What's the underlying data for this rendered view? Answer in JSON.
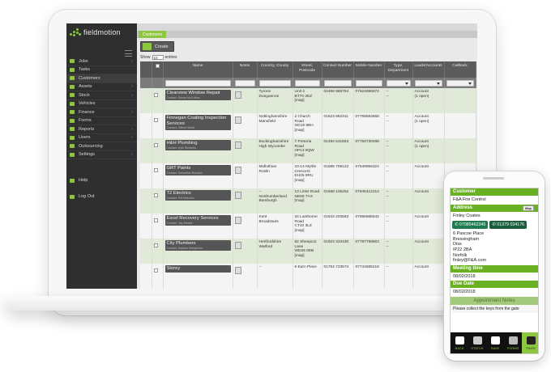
{
  "app": {
    "name": "fieldmotion"
  },
  "sidebar": {
    "items": [
      {
        "label": "Jobs",
        "arrow": "‹"
      },
      {
        "label": "Tasks",
        "arrow": ""
      },
      {
        "label": "Customers",
        "arrow": ""
      },
      {
        "label": "Assets",
        "arrow": "‹"
      },
      {
        "label": "Stock",
        "arrow": "‹"
      },
      {
        "label": "Vehicles",
        "arrow": ""
      },
      {
        "label": "Finance",
        "arrow": "‹"
      },
      {
        "label": "Forms",
        "arrow": ""
      },
      {
        "label": "Reports",
        "arrow": "‹"
      },
      {
        "label": "Users",
        "arrow": "‹"
      },
      {
        "label": "Outsourcing",
        "arrow": ""
      },
      {
        "label": "Settings",
        "arrow": "‹"
      }
    ],
    "help": "Help",
    "logout": "Log Out"
  },
  "tabs": {
    "active": "Customers"
  },
  "toolbar": {
    "create": "Create"
  },
  "table_controls": {
    "show": "Show",
    "entries_value": "10",
    "entries": "entries"
  },
  "table": {
    "headers": [
      "Name",
      "Notes",
      "Country, County",
      "Street, Postcode",
      "Contact Number",
      "Mobile Number",
      "Type, Department",
      "Leads/Accounts",
      "Callback"
    ],
    "rows": [
      {
        "name": "Clearview Window Repair",
        "contact": "Contact: Simon McCollins",
        "county": "Tyrone\nDungannon",
        "street": "Unit 2\nBT70 3EZ\n[map]",
        "phone": "02458 985754",
        "mobile": "07524896874",
        "type": "--\n--",
        "leads": "Account\n(1 open)"
      },
      {
        "name": "Finnegan Coating Inspection Services",
        "contact": "Contact: Gilbert Ward",
        "county": "Nottinghamshire\nMansfield",
        "street": "2 Church Road\nNG19 8BH\n[map]",
        "phone": "01623 882311",
        "mobile": "07768593658",
        "type": "--\n--",
        "leads": "Account\n(1 open)"
      },
      {
        "name": "H&H Plumbing",
        "contact": "Contact: Kyle Richards",
        "county": "Buckinghamshire\nHigh Wycombe",
        "street": "7 Pretoria Road\nHP13 6QW\n[map]",
        "phone": "01494 531553",
        "mobile": "07759730488",
        "type": "--\n--",
        "leads": "Account\n(1 open)"
      },
      {
        "name": "GRT Paints",
        "contact": "Contact: Sebastian Boulden",
        "county": "Midlothian\nRoslin",
        "street": "10-14 Myrtle Crescent\nEH25 9RU\n[map]",
        "phone": "01689 708122",
        "mobile": "07548956324",
        "type": "--\n--",
        "leads": "Account"
      },
      {
        "name": "T2 Electrics",
        "contact": "Contact: Pat Malcolm",
        "county": "--\nNorthumberland\nBamburgh",
        "street": "13 Links Road\nNE69 7AX\n[map]",
        "phone": "01668 105252",
        "mobile": "07845412214",
        "type": "--\n--",
        "leads": "Account"
      },
      {
        "name": "Excel Recovery Services",
        "contact": "Contact: Jay Weeks",
        "county": "Kent\nBroadstairs",
        "street": "34 Lanthorne Road\nCT10 3LZ\n[map]",
        "phone": "01843 203583",
        "mobile": "07966585542",
        "type": "--\n--",
        "leads": "Account"
      },
      {
        "name": "City Plumbers",
        "contact": "Contact: Andrew Humphries",
        "county": "Hertfordshire\nWatford",
        "street": "82 Sheepcot Lane\nWD25 0EB\n[map]",
        "phone": "01923 323430",
        "mobile": "07787799663",
        "type": "--\n--",
        "leads": "Account"
      },
      {
        "name": "Storey",
        "contact": "",
        "county": "--",
        "street": "6 Earn Place",
        "phone": "01764 723574",
        "mobile": "07744585218",
        "type": "--",
        "leads": "Account"
      }
    ]
  },
  "phone": {
    "customer_label": "Customer",
    "customer_value": "F&A Fire Control",
    "address_label": "Address",
    "map_label": "Map",
    "contact_name": "Finley Coates",
    "phone1": "07985462345",
    "phone2": "01379 034176",
    "address_lines": [
      "6 Pascoe Place",
      "Bressingham",
      "Diss",
      "IP22 2BA",
      "Norfolk",
      "finley@F&A.com"
    ],
    "meeting_label": "Meeting time",
    "meeting_value": "08/02/2018",
    "due_label": "Due Date",
    "due_value": "08/02/2018",
    "notes_label": "Appointment Notes",
    "notes_value": "Please collect the keys from the gate",
    "bottom_bar": [
      "BACK",
      "STATUS",
      "SAVE",
      "FORMS",
      "FILES"
    ]
  }
}
